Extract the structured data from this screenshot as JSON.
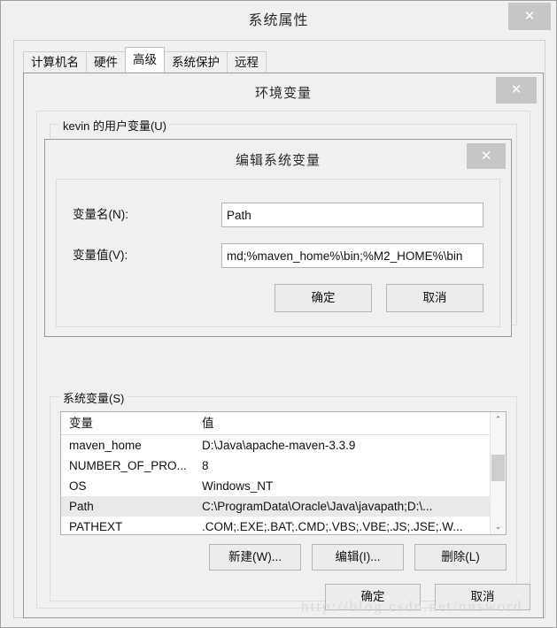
{
  "system_properties": {
    "title": "系统属性",
    "close_label": "✕",
    "tabs": [
      {
        "label": "计算机名",
        "active": false
      },
      {
        "label": "硬件",
        "active": false
      },
      {
        "label": "高级",
        "active": true
      },
      {
        "label": "系统保护",
        "active": false
      },
      {
        "label": "远程",
        "active": false
      }
    ]
  },
  "environment_variables": {
    "title": "环境变量",
    "close_label": "✕",
    "user_group_label": "kevin 的用户变量(U)",
    "system_group_label": "系统变量(S)",
    "table": {
      "columns": [
        "变量",
        "值"
      ],
      "rows": [
        {
          "variable": "maven_home",
          "value": "D:\\Java\\apache-maven-3.3.9",
          "selected": false
        },
        {
          "variable": "NUMBER_OF_PRO...",
          "value": "8",
          "selected": false
        },
        {
          "variable": "OS",
          "value": "Windows_NT",
          "selected": false
        },
        {
          "variable": "Path",
          "value": "C:\\ProgramData\\Oracle\\Java\\javapath;D:\\...",
          "selected": true
        },
        {
          "variable": "PATHEXT",
          "value": ".COM;.EXE;.BAT;.CMD;.VBS;.VBE;.JS;.JSE;.W...",
          "selected": false
        }
      ]
    },
    "scrollbar": {
      "up_glyph": "⌃",
      "down_glyph": "⌄"
    },
    "list_buttons": {
      "new": "新建(W)...",
      "edit": "编辑(I)...",
      "delete": "删除(L)"
    },
    "footer": {
      "ok": "确定",
      "cancel": "取消"
    }
  },
  "edit_variable": {
    "title": "编辑系统变量",
    "close_label": "✕",
    "name_label": "变量名(N):",
    "name_value": "Path",
    "value_label": "变量值(V):",
    "value_value": "md;%maven_home%\\bin;%M2_HOME%\\bin",
    "footer": {
      "ok": "确定",
      "cancel": "取消"
    }
  },
  "watermark": {
    "text": "http://blog.csdn.net/nnsword"
  },
  "colors": {
    "dialog_bg": "#f0f0f0",
    "close_button": "#c6c6c6",
    "selection": "#e9e9e9",
    "field_bg": "#ffffff",
    "border": "#b4b4b4"
  }
}
